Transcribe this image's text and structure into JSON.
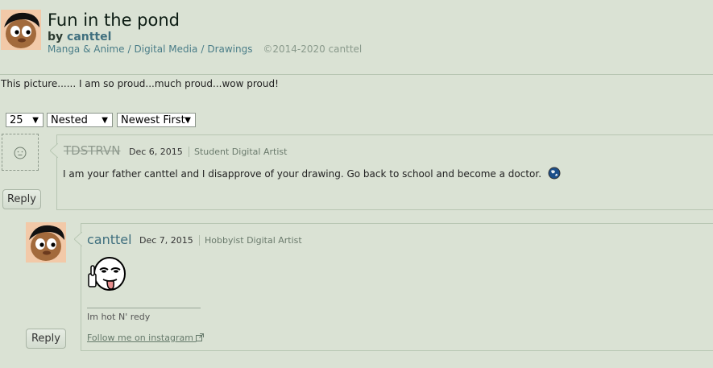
{
  "artwork": {
    "title": "Fun in the pond",
    "by_prefix": "by",
    "author": "canttel",
    "categories": [
      "Manga & Anime",
      "Digital Media",
      "Drawings"
    ],
    "category_separator": "/",
    "copyright": "©2014-2020 canttel",
    "description": "This picture...... I am so proud...much proud...wow proud!"
  },
  "controls": {
    "per_page": "25",
    "view_mode": "Nested",
    "sort_order": "Newest First"
  },
  "comments": [
    {
      "username": "TDSTRVN",
      "date": "Dec 6, 2015",
      "user_type": "Student Digital Artist",
      "text": "I am your father canttel and I disapprove of your drawing. Go back to school and become a doctor.",
      "reply_label": "Reply"
    },
    {
      "username": "canttel",
      "date": "Dec 7, 2015",
      "user_type": "Hobbyist Digital Artist",
      "signature": "Im hot N' redy",
      "link_text": "Follow me on instagram",
      "reply_label": "Reply"
    }
  ],
  "colors": {
    "background": "#dae2d4",
    "link": "#4a7d88",
    "username_link": "#3f6f7e"
  }
}
